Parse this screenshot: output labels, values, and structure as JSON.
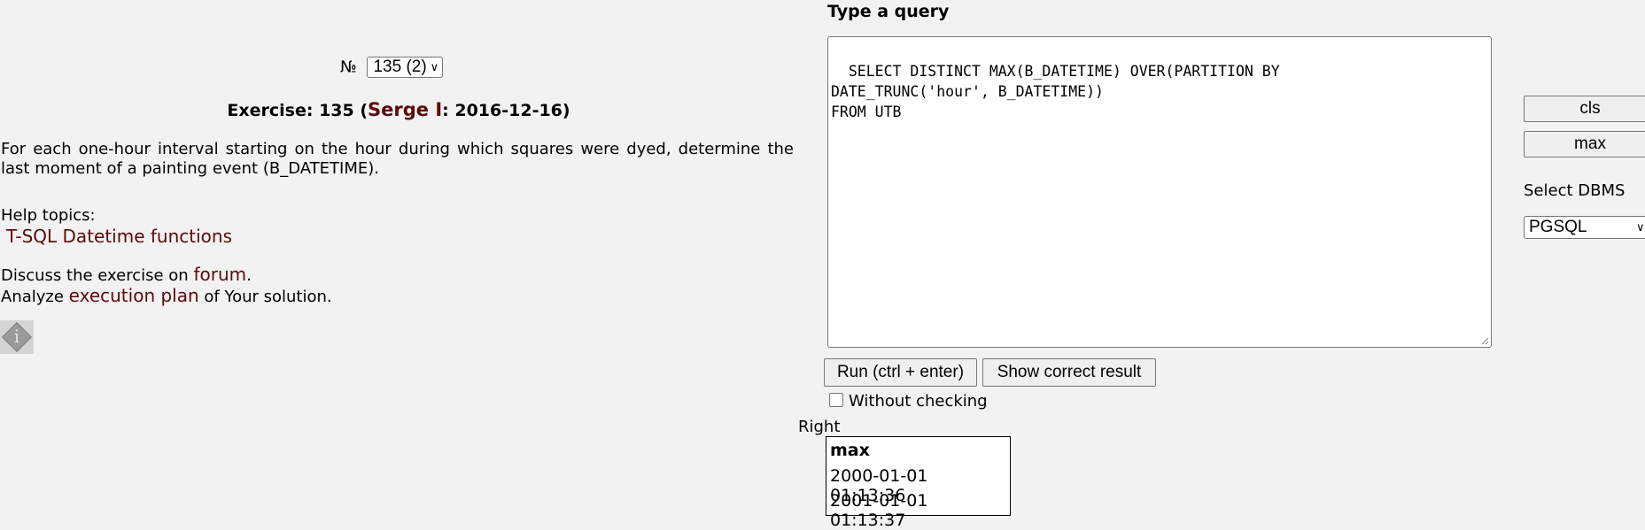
{
  "exercise_selector": {
    "prefix": "№",
    "value": "135 (2)"
  },
  "exercise": {
    "title_prefix": "Exercise: 135 (",
    "author": "Serge I",
    "title_suffix": ": 2016-12-16)",
    "description": "For each one-hour interval starting on the hour during which squares were dyed, determine the last moment of a painting event (B_DATETIME)."
  },
  "help": {
    "heading": "Help topics:",
    "topic": "T-SQL Datetime functions"
  },
  "discuss": {
    "before": "Discuss the exercise on ",
    "link": "forum",
    "after": "."
  },
  "analyze": {
    "before": "Analyze ",
    "link": "execution plan",
    "after": " of Your solution."
  },
  "query": {
    "label": "Type a query",
    "text": "SELECT DISTINCT MAX(B_DATETIME) OVER(PARTITION BY\nDATE_TRUNC('hour', B_DATETIME))\nFROM UTB"
  },
  "buttons": {
    "run": "Run (ctrl + enter)",
    "show_result": "Show correct result",
    "cls": "cls",
    "max": "max"
  },
  "without_checking": {
    "label": "Without checking",
    "checked": false
  },
  "dbms": {
    "label": "Select DBMS",
    "value": "PGSQL"
  },
  "result": {
    "status": "Right",
    "header": "max",
    "rows": [
      "2000-01-01 01:13:36",
      "2001-01-01 01:13:37"
    ]
  }
}
